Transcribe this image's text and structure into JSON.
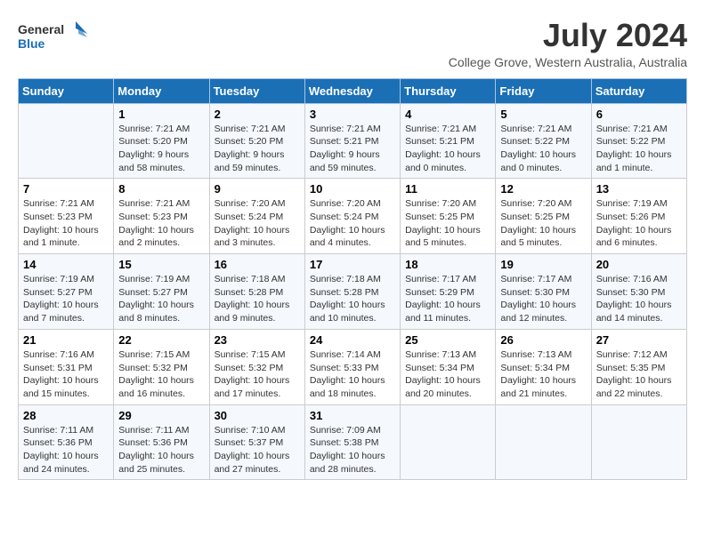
{
  "header": {
    "logo_line1": "General",
    "logo_line2": "Blue",
    "month_year": "July 2024",
    "location": "College Grove, Western Australia, Australia"
  },
  "weekdays": [
    "Sunday",
    "Monday",
    "Tuesday",
    "Wednesday",
    "Thursday",
    "Friday",
    "Saturday"
  ],
  "weeks": [
    [
      {
        "day": "",
        "sunrise": "",
        "sunset": "",
        "daylight": ""
      },
      {
        "day": "1",
        "sunrise": "Sunrise: 7:21 AM",
        "sunset": "Sunset: 5:20 PM",
        "daylight": "Daylight: 9 hours and 58 minutes."
      },
      {
        "day": "2",
        "sunrise": "Sunrise: 7:21 AM",
        "sunset": "Sunset: 5:20 PM",
        "daylight": "Daylight: 9 hours and 59 minutes."
      },
      {
        "day": "3",
        "sunrise": "Sunrise: 7:21 AM",
        "sunset": "Sunset: 5:21 PM",
        "daylight": "Daylight: 9 hours and 59 minutes."
      },
      {
        "day": "4",
        "sunrise": "Sunrise: 7:21 AM",
        "sunset": "Sunset: 5:21 PM",
        "daylight": "Daylight: 10 hours and 0 minutes."
      },
      {
        "day": "5",
        "sunrise": "Sunrise: 7:21 AM",
        "sunset": "Sunset: 5:22 PM",
        "daylight": "Daylight: 10 hours and 0 minutes."
      },
      {
        "day": "6",
        "sunrise": "Sunrise: 7:21 AM",
        "sunset": "Sunset: 5:22 PM",
        "daylight": "Daylight: 10 hours and 1 minute."
      }
    ],
    [
      {
        "day": "7",
        "sunrise": "Sunrise: 7:21 AM",
        "sunset": "Sunset: 5:23 PM",
        "daylight": "Daylight: 10 hours and 1 minute."
      },
      {
        "day": "8",
        "sunrise": "Sunrise: 7:21 AM",
        "sunset": "Sunset: 5:23 PM",
        "daylight": "Daylight: 10 hours and 2 minutes."
      },
      {
        "day": "9",
        "sunrise": "Sunrise: 7:20 AM",
        "sunset": "Sunset: 5:24 PM",
        "daylight": "Daylight: 10 hours and 3 minutes."
      },
      {
        "day": "10",
        "sunrise": "Sunrise: 7:20 AM",
        "sunset": "Sunset: 5:24 PM",
        "daylight": "Daylight: 10 hours and 4 minutes."
      },
      {
        "day": "11",
        "sunrise": "Sunrise: 7:20 AM",
        "sunset": "Sunset: 5:25 PM",
        "daylight": "Daylight: 10 hours and 5 minutes."
      },
      {
        "day": "12",
        "sunrise": "Sunrise: 7:20 AM",
        "sunset": "Sunset: 5:25 PM",
        "daylight": "Daylight: 10 hours and 5 minutes."
      },
      {
        "day": "13",
        "sunrise": "Sunrise: 7:19 AM",
        "sunset": "Sunset: 5:26 PM",
        "daylight": "Daylight: 10 hours and 6 minutes."
      }
    ],
    [
      {
        "day": "14",
        "sunrise": "Sunrise: 7:19 AM",
        "sunset": "Sunset: 5:27 PM",
        "daylight": "Daylight: 10 hours and 7 minutes."
      },
      {
        "day": "15",
        "sunrise": "Sunrise: 7:19 AM",
        "sunset": "Sunset: 5:27 PM",
        "daylight": "Daylight: 10 hours and 8 minutes."
      },
      {
        "day": "16",
        "sunrise": "Sunrise: 7:18 AM",
        "sunset": "Sunset: 5:28 PM",
        "daylight": "Daylight: 10 hours and 9 minutes."
      },
      {
        "day": "17",
        "sunrise": "Sunrise: 7:18 AM",
        "sunset": "Sunset: 5:28 PM",
        "daylight": "Daylight: 10 hours and 10 minutes."
      },
      {
        "day": "18",
        "sunrise": "Sunrise: 7:17 AM",
        "sunset": "Sunset: 5:29 PM",
        "daylight": "Daylight: 10 hours and 11 minutes."
      },
      {
        "day": "19",
        "sunrise": "Sunrise: 7:17 AM",
        "sunset": "Sunset: 5:30 PM",
        "daylight": "Daylight: 10 hours and 12 minutes."
      },
      {
        "day": "20",
        "sunrise": "Sunrise: 7:16 AM",
        "sunset": "Sunset: 5:30 PM",
        "daylight": "Daylight: 10 hours and 14 minutes."
      }
    ],
    [
      {
        "day": "21",
        "sunrise": "Sunrise: 7:16 AM",
        "sunset": "Sunset: 5:31 PM",
        "daylight": "Daylight: 10 hours and 15 minutes."
      },
      {
        "day": "22",
        "sunrise": "Sunrise: 7:15 AM",
        "sunset": "Sunset: 5:32 PM",
        "daylight": "Daylight: 10 hours and 16 minutes."
      },
      {
        "day": "23",
        "sunrise": "Sunrise: 7:15 AM",
        "sunset": "Sunset: 5:32 PM",
        "daylight": "Daylight: 10 hours and 17 minutes."
      },
      {
        "day": "24",
        "sunrise": "Sunrise: 7:14 AM",
        "sunset": "Sunset: 5:33 PM",
        "daylight": "Daylight: 10 hours and 18 minutes."
      },
      {
        "day": "25",
        "sunrise": "Sunrise: 7:13 AM",
        "sunset": "Sunset: 5:34 PM",
        "daylight": "Daylight: 10 hours and 20 minutes."
      },
      {
        "day": "26",
        "sunrise": "Sunrise: 7:13 AM",
        "sunset": "Sunset: 5:34 PM",
        "daylight": "Daylight: 10 hours and 21 minutes."
      },
      {
        "day": "27",
        "sunrise": "Sunrise: 7:12 AM",
        "sunset": "Sunset: 5:35 PM",
        "daylight": "Daylight: 10 hours and 22 minutes."
      }
    ],
    [
      {
        "day": "28",
        "sunrise": "Sunrise: 7:11 AM",
        "sunset": "Sunset: 5:36 PM",
        "daylight": "Daylight: 10 hours and 24 minutes."
      },
      {
        "day": "29",
        "sunrise": "Sunrise: 7:11 AM",
        "sunset": "Sunset: 5:36 PM",
        "daylight": "Daylight: 10 hours and 25 minutes."
      },
      {
        "day": "30",
        "sunrise": "Sunrise: 7:10 AM",
        "sunset": "Sunset: 5:37 PM",
        "daylight": "Daylight: 10 hours and 27 minutes."
      },
      {
        "day": "31",
        "sunrise": "Sunrise: 7:09 AM",
        "sunset": "Sunset: 5:38 PM",
        "daylight": "Daylight: 10 hours and 28 minutes."
      },
      {
        "day": "",
        "sunrise": "",
        "sunset": "",
        "daylight": ""
      },
      {
        "day": "",
        "sunrise": "",
        "sunset": "",
        "daylight": ""
      },
      {
        "day": "",
        "sunrise": "",
        "sunset": "",
        "daylight": ""
      }
    ]
  ]
}
